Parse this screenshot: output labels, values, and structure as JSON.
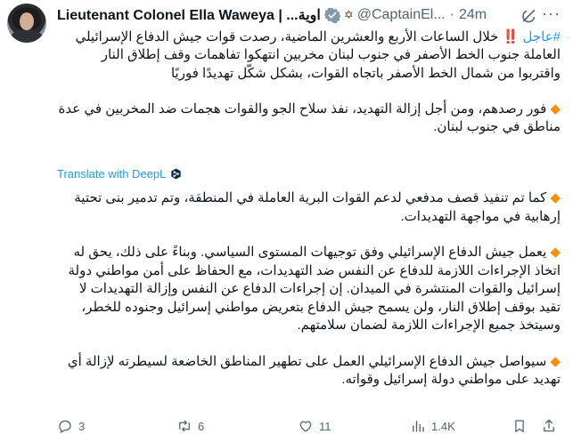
{
  "tweet": {
    "author_name": "Lieutenant Colonel Ella Waweya | ...اوية",
    "handle": "@CaptainEl...",
    "separator": "·",
    "time": "24m",
    "flag_glyph": "✡",
    "hashtag": "#عاجل",
    "exclamation": "‼️",
    "p1": "خلال الساعات الأربع والعشرين الماضية، رصدت قوات جيش الدفاع الإسرائيلي العاملة جنوب الخط الأصفر في جنوب لبنان مخربين انتهكوا تفاهمات وقف إطلاق النار واقتربوا من شمال الخط الأصفر باتجاه القوات، بشكل شكّل تهديدًا فوريًا",
    "bullet": "◆",
    "p2": "فور رصدهم، ومن أجل إزالة التهديد، نفذ سلاح الجو والقوات هجمات ضد المخربين في عدة مناطق في جنوب لبنان.",
    "translate_label": "Translate with DeepL",
    "p3": "كما تم تنفيذ قصف مدفعي لدعم القوات البرية العاملة في المنطقة، وتم تدمير بنى تحتية إرهابية في مواجهة التهديدات.",
    "p4": "يعمل جيش الدفاع الإسرائيلي وفق توجيهات المستوى السياسي. وبناءً على ذلك، يحق له اتخاذ الإجراءات اللازمة للدفاع عن النفس ضد التهديدات، مع الحفاظ على أمن مواطني دولة إسرائيل والقوات المنتشرة في الميدان. إن إجراءات الدفاع عن النفس وإزالة التهديدات لا تقيد بوقف إطلاق النار، ولن يسمح جيش الدفاع بتعريض مواطني إسرائيل وجنوده للخطر، وسيتخذ جميع الإجراءات اللازمة لضمان سلامتهم.",
    "p5": "سيواصل جيش الدفاع الإسرائيلي العمل على تطهير المناطق الخاضعة لسيطرته لإزالة أي تهديد على مواطني دولة إسرائيل وقواته."
  },
  "actions": {
    "replies": "3",
    "reposts": "6",
    "likes": "11",
    "views": "1.4K"
  },
  "colors": {
    "accent": "#1d9bf0",
    "text": "#0f1419",
    "muted": "#536471",
    "bullet": "#f4900c",
    "alert": "#d62c2c"
  },
  "icons": [
    "verified-badge-icon",
    "grok-icon",
    "more-icon",
    "reply-icon",
    "repost-icon",
    "like-icon",
    "views-icon",
    "bookmark-icon",
    "share-icon",
    "deepl-icon"
  ]
}
